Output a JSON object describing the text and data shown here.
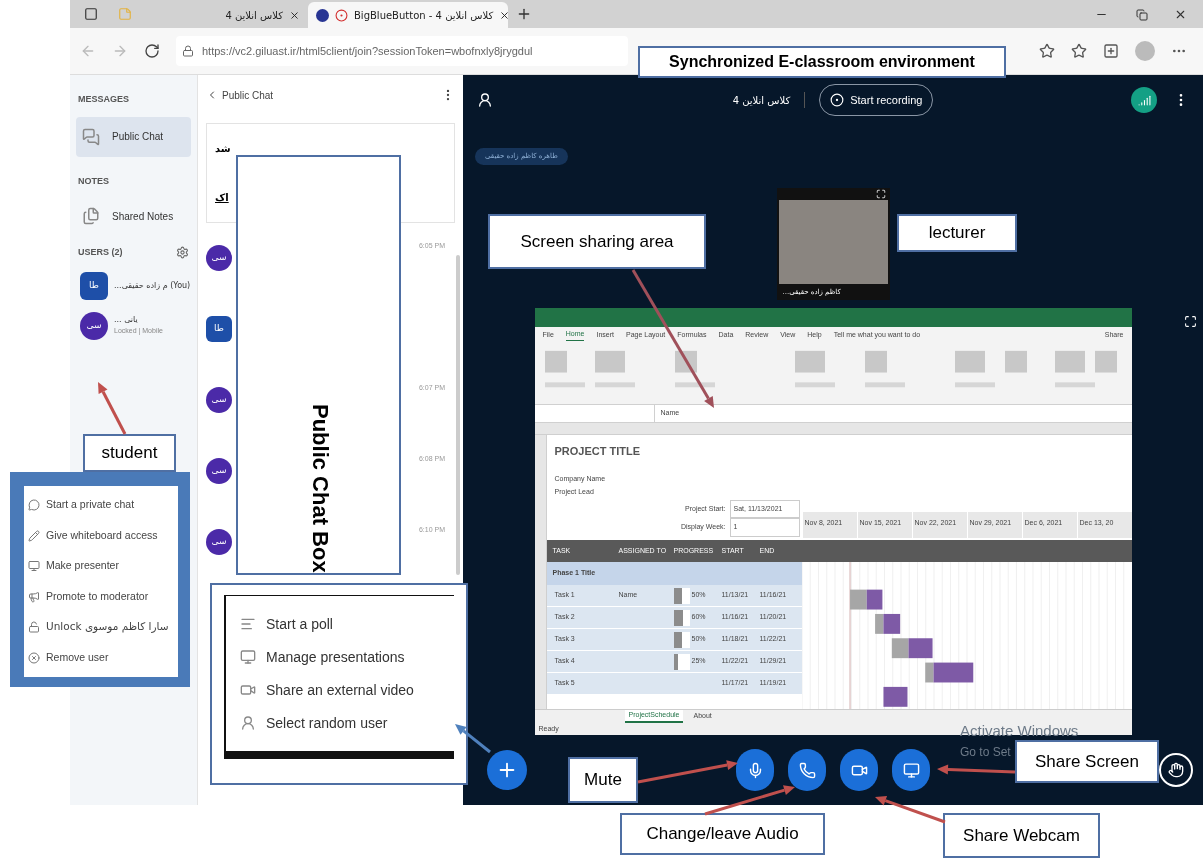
{
  "browser": {
    "tabs": [
      {
        "label": "کلاس انلاین 4",
        "selected": false
      },
      {
        "label": "BigBlueButton - کلاس انلاین 4",
        "selected": true
      }
    ],
    "url": "https://vc2.giluast.ir/html5client/join?sessionToken=wbofnxly8jrygdul"
  },
  "sidebar": {
    "messages_heading": "MESSAGES",
    "messages": [
      {
        "label": "Public Chat",
        "selected": true
      }
    ],
    "notes_heading": "NOTES",
    "notes": [
      {
        "label": "Shared Notes",
        "selected": false
      }
    ],
    "users_heading": "USERS (2)",
    "users": [
      {
        "initials": "طا",
        "kind": "square",
        "color": "#1e4fa8",
        "name": "...م زاده حقیقی",
        "tag": "(You)"
      },
      {
        "initials": "سی",
        "kind": "circle",
        "color": "#4b2aa8",
        "name": "... یانی",
        "status": "Locked | Mobile"
      }
    ]
  },
  "chat": {
    "title": "Public Chat",
    "welcome": [
      "شد",
      "اک"
    ],
    "messages": [
      {
        "initials": "سی",
        "kind": "circle",
        "color": "#4b2aa8",
        "time": "6:05 PM"
      },
      {
        "initials": "طا",
        "kind": "square",
        "color": "#1e4fa8"
      },
      {
        "initials": "سی",
        "kind": "circle",
        "color": "#4b2aa8",
        "time": "6:07 PM"
      },
      {
        "initials": "سی",
        "kind": "circle",
        "color": "#4b2aa8",
        "time": "6:08 PM"
      },
      {
        "initials": "سی",
        "kind": "circle",
        "color": "#4b2aa8",
        "time": "6:10 PM"
      }
    ]
  },
  "user_menu": [
    "Start a private chat",
    "Give whiteboard access",
    "Make presenter",
    "Promote to moderator",
    "Unlock سارا کاظم موسوی",
    "Remove user"
  ],
  "actions_menu": [
    "Start a poll",
    "Manage presentations",
    "Share an external video",
    "Select random user"
  ],
  "main": {
    "meeting_title": "کلاس انلاین 4",
    "record_button": "Start recording",
    "presenter_chip": "طاهره کاظم زاده حقیقی",
    "webcam_caption": "...کاظم زاده حقیقی",
    "os_notice": [
      "Activate Windows",
      "Go to Set"
    ]
  },
  "shared_screen": {
    "ribbon_tabs": [
      {
        "label": "File",
        "selected": false
      },
      {
        "label": "Home",
        "selected": true
      },
      {
        "label": "Insert",
        "selected": false
      },
      {
        "label": "Page Layout",
        "selected": false
      },
      {
        "label": "Formulas",
        "selected": false
      },
      {
        "label": "Data",
        "selected": false
      },
      {
        "label": "Review",
        "selected": false
      },
      {
        "label": "View",
        "selected": false
      },
      {
        "label": "Help",
        "selected": false
      }
    ],
    "tell_me": "Tell me what you want to do",
    "share": "Share",
    "formula_value": "Name",
    "project_title": "PROJECT TITLE",
    "company": "Company Name",
    "lead": "Project Lead",
    "start_label": "Project Start:",
    "start_value": "Sat, 11/13/2021",
    "week_label": "Display Week:",
    "week_value": "1",
    "weeks": [
      "Nov 8, 2021",
      "Nov 15, 2021",
      "Nov 22, 2021",
      "Nov 29, 2021",
      "Dec 6, 2021",
      "Dec 13, 20"
    ],
    "columns": [
      "TASK",
      "ASSIGNED TO",
      "PROGRESS",
      "START",
      "END"
    ],
    "phase": "Phase 1 Title",
    "tasks": [
      {
        "task": "Task 1",
        "assigned": "Name",
        "progress": "50%",
        "level": 0.5,
        "start": "11/13/21",
        "end": "11/16/21"
      },
      {
        "task": "Task 2",
        "progress": "60%",
        "level": 0.6,
        "start": "11/16/21",
        "end": "11/20/21"
      },
      {
        "task": "Task 3",
        "progress": "50%",
        "level": 0.5,
        "start": "11/18/21",
        "end": "11/22/21"
      },
      {
        "task": "Task 4",
        "progress": "25%",
        "level": 0.25,
        "start": "11/22/21",
        "end": "11/29/21"
      },
      {
        "task": "Task 5",
        "start": "11/17/21",
        "end": "11/19/21"
      }
    ],
    "sheets": [
      {
        "label": "ProjectSchedule",
        "selected": true
      },
      {
        "label": "About",
        "selected": false
      }
    ],
    "status": "Ready"
  },
  "annotations": [
    {
      "text": "Synchronized E-classroom environment",
      "kind": "title"
    },
    {
      "text": "Screen sharing area",
      "kind": "box"
    },
    {
      "text": "lecturer",
      "kind": "box"
    },
    {
      "text": "Public Chat Box",
      "kind": "vertical"
    },
    {
      "text": "student",
      "kind": "box"
    },
    {
      "text": "Mute",
      "kind": "box"
    },
    {
      "text": "Change/leave Audio",
      "kind": "box"
    },
    {
      "text": "Share Webcam",
      "kind": "box"
    },
    {
      "text": "Share Screen",
      "kind": "box"
    }
  ]
}
